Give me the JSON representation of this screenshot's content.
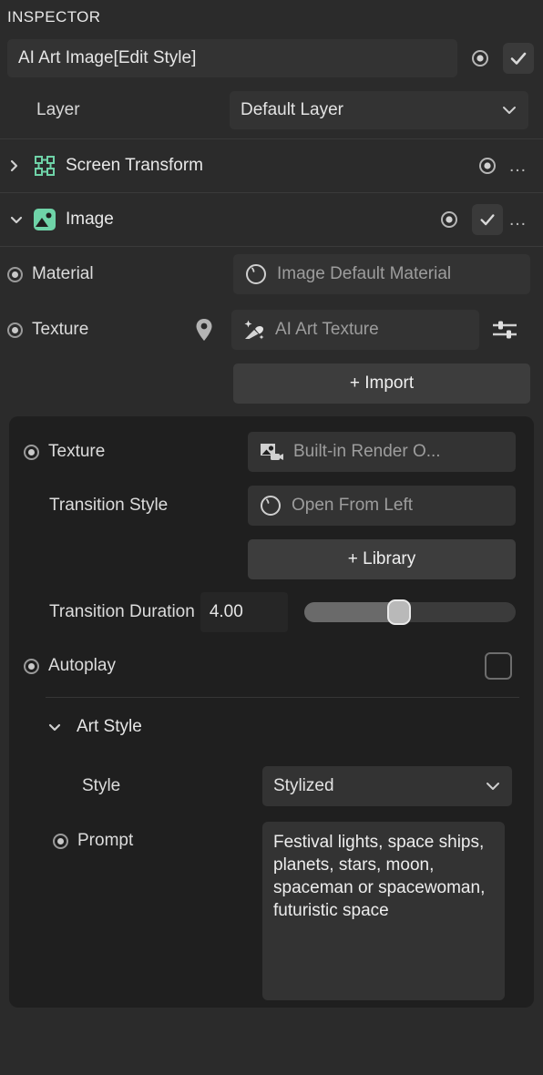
{
  "header": {
    "title": "INSPECTOR",
    "object_name": "AI Art Image[Edit Style]",
    "target_icon": "record-dot-icon",
    "enabled_icon": "check-icon"
  },
  "layer": {
    "label": "Layer",
    "value": "Default Layer",
    "chevron": "chevron-down-icon"
  },
  "components": [
    {
      "name": "Screen Transform",
      "expanded": false,
      "caret": "chevron-right-icon",
      "icon": "screen-transform-icon",
      "menu": "…"
    },
    {
      "name": "Image",
      "expanded": true,
      "caret": "chevron-down-icon",
      "icon": "image-icon",
      "menu": "…"
    }
  ],
  "image_component": {
    "material": {
      "label": "Material",
      "value": "Image Default Material",
      "icon": "material-sphere-icon"
    },
    "texture": {
      "label": "Texture",
      "value": "AI Art Texture",
      "pin_icon": "pin-icon",
      "icon": "magic-brush-icon",
      "settings_icon": "sliders-icon"
    },
    "import_button": "+ Import"
  },
  "sub_panel": {
    "texture": {
      "label": "Texture",
      "value": "Built-in Render O...",
      "icon": "render-target-icon"
    },
    "transition_style": {
      "label": "Transition Style",
      "value": "Open From Left",
      "icon": "circle-transition-icon"
    },
    "library_button": "+ Library",
    "transition_duration": {
      "label": "Transition Duration",
      "value": "4.00",
      "slider_percent": 45
    },
    "autoplay": {
      "label": "Autoplay",
      "checked": false
    },
    "art_style": {
      "label": "Art Style",
      "caret": "chevron-down-icon",
      "style": {
        "label": "Style",
        "value": "Stylized",
        "chevron": "chevron-down-icon"
      },
      "prompt": {
        "label": "Prompt",
        "value": "Festival lights, space ships, planets, stars, moon, spaceman or spacewoman, futuristic space"
      }
    }
  },
  "colors": {
    "background": "#2b2b2b",
    "sub_panel": "#1f1f1f",
    "field": "#333333",
    "button": "#3d3d3d",
    "accent_green": "#6fd3a8",
    "text": "#e8e8e8",
    "text_muted": "#9d9d9d"
  }
}
